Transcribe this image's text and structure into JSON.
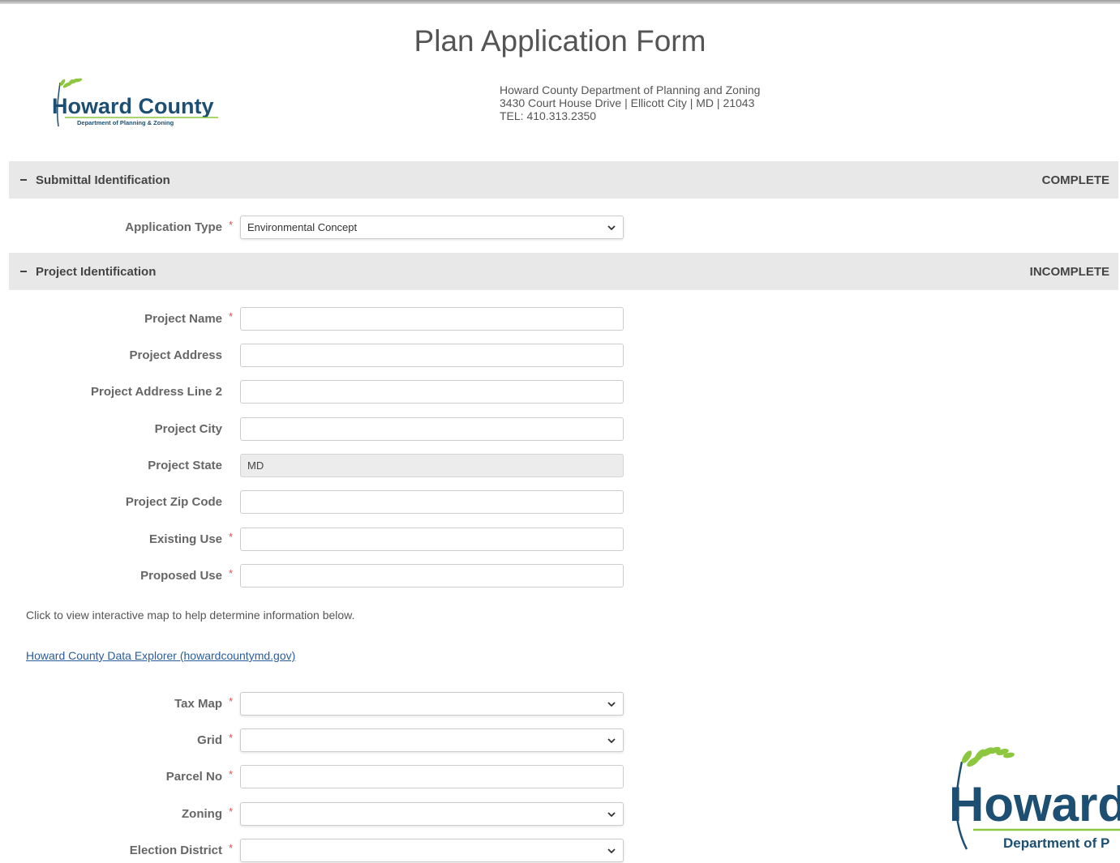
{
  "page": {
    "title": "Plan Application Form"
  },
  "brand": {
    "logo_name": "Howard County",
    "logo_subtitle": "Department of Planning & Zoning",
    "footer_logo_name": "Howard",
    "footer_logo_subtitle": "Department of P",
    "primary_color": "#1d4f73",
    "accent_color": "#8dc63f"
  },
  "department": {
    "name": "Howard County Department of Planning and Zoning",
    "address": "3430 Court House Drive | Ellicott City | MD | 21043",
    "phone": "TEL: 410.313.2350"
  },
  "sections": {
    "submittal": {
      "title": "Submittal Identification",
      "status": "COMPLETE"
    },
    "project": {
      "title": "Project Identification",
      "status": "INCOMPLETE"
    }
  },
  "fields": {
    "application_type": {
      "label": "Application Type",
      "value": "Environmental Concept",
      "required": true
    },
    "project_name": {
      "label": "Project Name",
      "value": "",
      "required": true
    },
    "project_address": {
      "label": "Project Address",
      "value": ""
    },
    "project_address_2": {
      "label": "Project Address Line 2",
      "value": ""
    },
    "project_city": {
      "label": "Project City",
      "value": ""
    },
    "project_state": {
      "label": "Project State",
      "value": "MD"
    },
    "project_zip": {
      "label": "Project Zip Code",
      "value": ""
    },
    "existing_use": {
      "label": "Existing Use",
      "value": "",
      "required": true
    },
    "proposed_use": {
      "label": "Proposed Use",
      "value": "",
      "required": true
    },
    "tax_map": {
      "label": "Tax Map",
      "value": "",
      "required": true
    },
    "grid": {
      "label": "Grid",
      "value": "",
      "required": true
    },
    "parcel_no": {
      "label": "Parcel No",
      "value": "",
      "required": true
    },
    "zoning": {
      "label": "Zoning",
      "value": "",
      "required": true
    },
    "election_district": {
      "label": "Election District",
      "value": "",
      "required": true
    }
  },
  "help": {
    "map_text": "Click to view interactive map to help determine information below.",
    "link_text": "Howard County Data Explorer (howardcountymd.gov)"
  },
  "required_mark": "*"
}
